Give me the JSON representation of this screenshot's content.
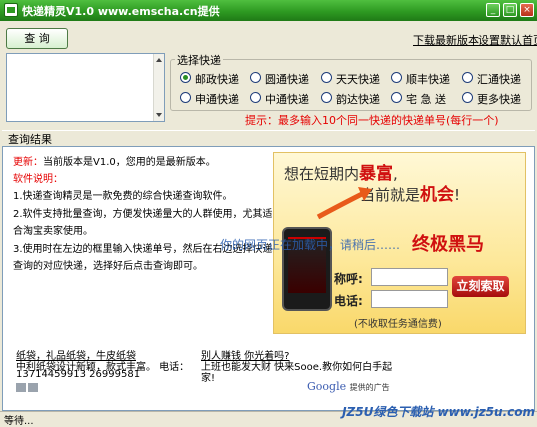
{
  "window": {
    "title": "快递精灵V1.0 www.emscha.cn提供",
    "controls": [
      "_",
      "□",
      "×"
    ]
  },
  "toolbar": {
    "query_label": "查 询",
    "download_link": "下载最新版本",
    "homepage_link": "设置默认首页"
  },
  "carrier_group": {
    "label": "选择快递",
    "options": [
      {
        "label": "邮政快递",
        "selected": true
      },
      {
        "label": "圆通快递",
        "selected": false
      },
      {
        "label": "天天快递",
        "selected": false
      },
      {
        "label": "顺丰快递",
        "selected": false
      },
      {
        "label": "汇通快递",
        "selected": false
      },
      {
        "label": "申通快递",
        "selected": false
      },
      {
        "label": "中通快递",
        "selected": false
      },
      {
        "label": "韵达快递",
        "selected": false
      },
      {
        "label": "宅 急 送",
        "selected": false
      },
      {
        "label": "更多快递",
        "selected": false
      }
    ]
  },
  "hint": "提示：最多输入10个同一快递的快递单号(每行一个)",
  "results": {
    "title": "查询结果",
    "update_prefix": "更新：",
    "update_text": "当前版本是V1.0，您用的是最新版本。",
    "instructions_title": "软件说明：",
    "lines": [
      "1.快递查询精灵是一款免费的综合快递查询软件。",
      "2.软件支持批量查询，方便发快递量大的人群使用，尤其适",
      "合淘宝卖家使用。",
      "3.使用时在左边的框里输入快递单号，然后在右边选择快递",
      "查询的对应快递，选择好后点击查询即可。"
    ],
    "overlay_text": "你的网页正在加载中，请稍后……"
  },
  "ad_banner": {
    "line1": "想在短期内",
    "line1_em": "暴富",
    "line1_end": ",",
    "line2": "当前就是",
    "line2_em": "机会",
    "line2_end": "!",
    "line3": "终极黑马",
    "phone_label": "称呼:",
    "tel_label": "电话:",
    "button": "立刻索取",
    "note": "(不收取任务通信费)"
  },
  "google_ads": {
    "ad1_title": "纸袋，礼品纸袋，牛皮纸袋",
    "ad1_line1": "中利纸袋设计新颖，款式丰富。 电话：",
    "ad1_line2": "13714459913 26999581",
    "ad2_title": "别人赚钱 你光着吗?",
    "ad2_line1": "上班也能发大财 快来Sooe.教你如何白手起",
    "ad2_line2": "家!",
    "attribution_brand": "Google",
    "attribution_text": "提供的广告"
  },
  "status": "等待...",
  "watermark": "JZ5U绿色下载站 www.jz5u.com",
  "colors": {
    "title_green": "#2e9a22",
    "hint_red": "#e60000",
    "ad_yellow": "#fde89a",
    "ad_button_red": "#c21010"
  }
}
